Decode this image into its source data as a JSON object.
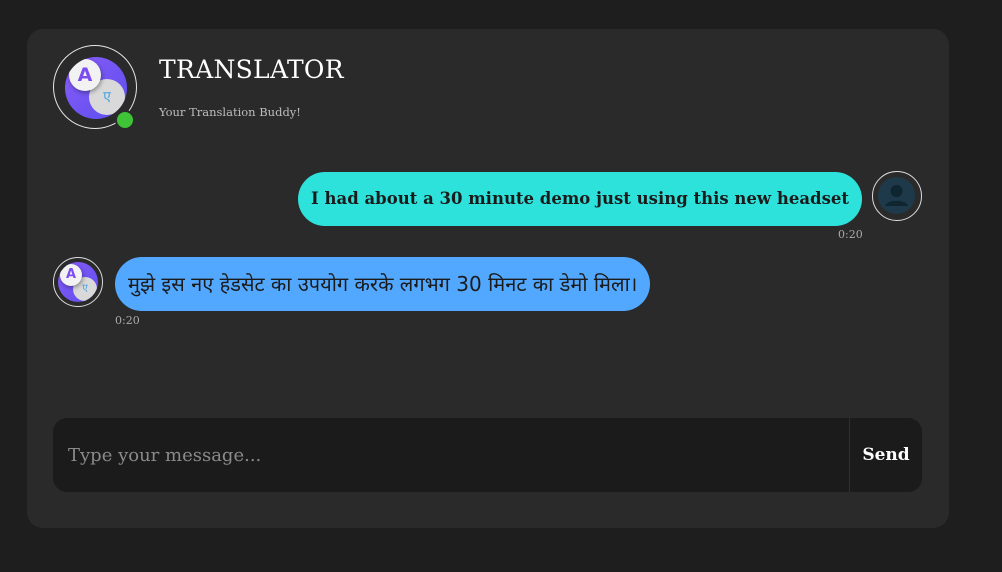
{
  "header": {
    "title": "TRANSLATOR",
    "subtitle": "Your Translation Buddy!",
    "logo_letter_a": "A",
    "logo_letter_b": "ए"
  },
  "messages": [
    {
      "role": "user",
      "text": "I had about a 30 minute demo just using this new headset",
      "time": "0:20"
    },
    {
      "role": "bot",
      "text": "मुझे इस नए हेडसेट का उपयोग करके लगभग 30 मिनट का डेमो मिला।",
      "time": "0:20"
    }
  ],
  "composer": {
    "placeholder": "Type your message...",
    "value": "",
    "send_label": "Send"
  },
  "colors": {
    "background": "#1e1e1e",
    "card": "#2a2a2a",
    "user_bubble": "#2ee2dc",
    "bot_bubble": "#52a8ff",
    "online": "#3fc437"
  },
  "icons": {
    "user_avatar": "user-icon",
    "logo": "translate-logo"
  }
}
